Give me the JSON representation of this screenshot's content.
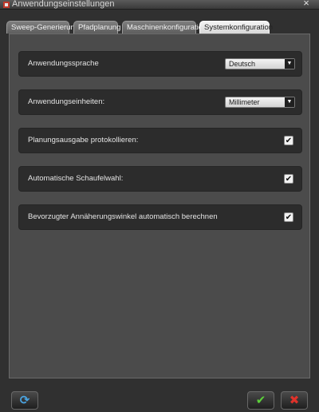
{
  "window": {
    "title": "Anwendungseinstellungen",
    "close_label": "×"
  },
  "tabs": [
    {
      "label": "Sweep-Generierung",
      "active": false
    },
    {
      "label": "Pfadplanung",
      "active": false
    },
    {
      "label": "Maschinenkonfiguration",
      "active": false
    },
    {
      "label": "Systemkonfiguration",
      "active": true
    }
  ],
  "settings": {
    "language": {
      "label": "Anwendungssprache",
      "value": "Deutsch"
    },
    "units": {
      "label": "Anwendungseinheiten:",
      "value": "Millimeter"
    },
    "log_planning": {
      "label": "Planungsausgabe protokollieren:",
      "checked": true
    },
    "auto_shovel": {
      "label": "Automatische Schaufelwahl:",
      "checked": true
    },
    "approach_angle": {
      "label": "Bevorzugter Annäherungswinkel automatisch berechnen",
      "checked": true
    }
  },
  "icons": {
    "check": "✔",
    "dropdown": "▼",
    "refresh": "⟳",
    "confirm": "✔",
    "cancel": "✖"
  },
  "colors": {
    "confirm_green": "#5cd13a",
    "cancel_red": "#e0322a",
    "refresh_blue": "#4aa3e0"
  }
}
